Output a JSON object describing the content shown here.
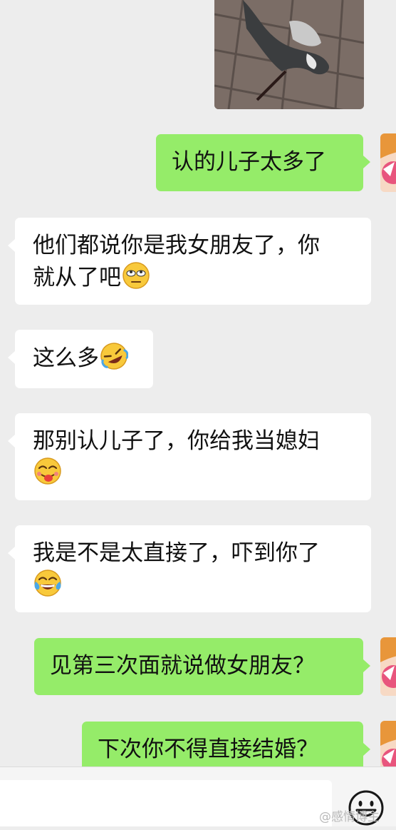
{
  "chat": {
    "messages": [
      {
        "side": "out",
        "text": "认的儿子太多了"
      },
      {
        "side": "in",
        "line1": "他们都说你是我女朋友了，你",
        "line2": "就从了吧",
        "emoji": "rolling-eyes-emoji"
      },
      {
        "side": "in",
        "text": "这么多",
        "emoji": "rofl-emoji"
      },
      {
        "side": "in",
        "line1": "那别认儿子了，你给我当媳妇",
        "emoji": "yum-emoji"
      },
      {
        "side": "in",
        "line1": "我是不是太直接了，吓到你了",
        "emoji": "tears-of-joy-emoji"
      },
      {
        "side": "out",
        "text": "见第三次面就说做女朋友？"
      },
      {
        "side": "out",
        "text": "下次你不得直接结婚？"
      }
    ]
  },
  "colors": {
    "background": "#ededed",
    "outgoing_bubble": "#95ec69",
    "incoming_bubble": "#ffffff"
  },
  "watermark": "@感情博主"
}
